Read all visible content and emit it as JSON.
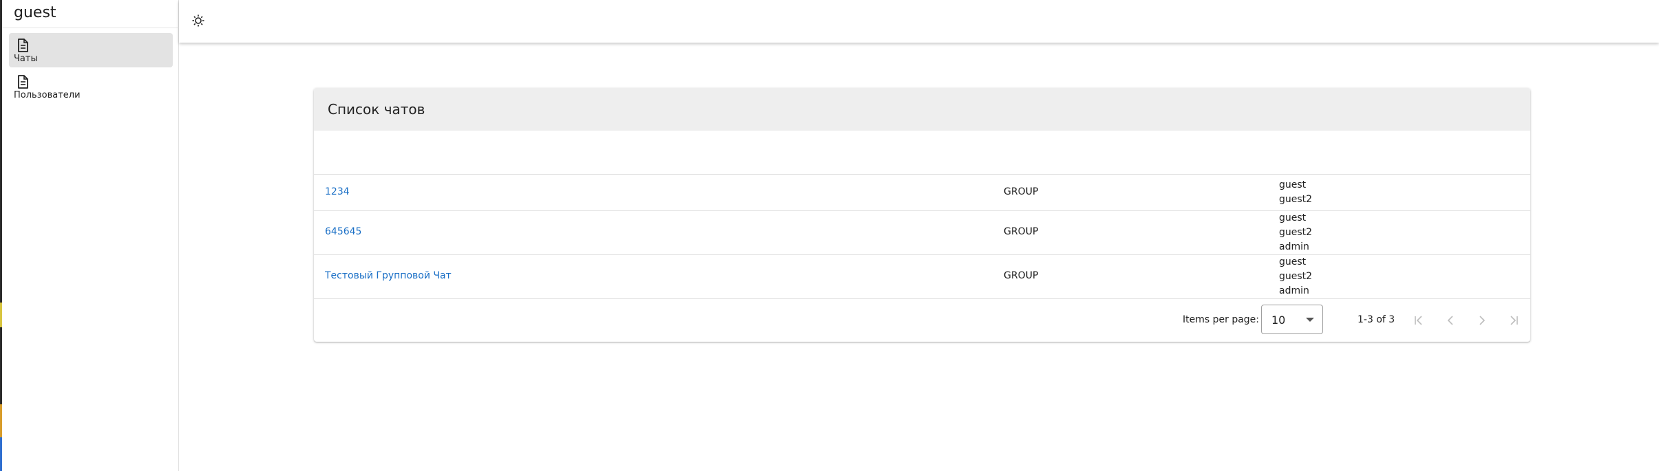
{
  "sidebar": {
    "user": "guest",
    "items": [
      {
        "label": "Чаты",
        "icon": "document-icon",
        "active": true
      },
      {
        "label": "Пользователи",
        "icon": "document-icon",
        "active": false
      }
    ]
  },
  "topbar": {
    "theme_icon": "sun-theme-icon"
  },
  "card": {
    "title": "Список чатов",
    "rows": [
      {
        "name": "1234",
        "type": "GROUP",
        "users": [
          "guest",
          "guest2"
        ]
      },
      {
        "name": "645645",
        "type": "GROUP",
        "users": [
          "guest",
          "guest2",
          "admin"
        ]
      },
      {
        "name": "Тестовый Групповой Чат",
        "type": "GROUP",
        "users": [
          "guest",
          "guest2",
          "admin"
        ]
      }
    ]
  },
  "pagination": {
    "items_per_page_label": "Items per page:",
    "items_per_page_value": "10",
    "range_label": "1-3 of 3",
    "buttons": [
      "first-page-icon",
      "previous-page-icon",
      "next-page-icon",
      "last-page-icon"
    ]
  },
  "colors": {
    "link": "#1a6fc6",
    "header_bg": "#eeeeee",
    "active_nav_bg": "#e3e3e3"
  }
}
